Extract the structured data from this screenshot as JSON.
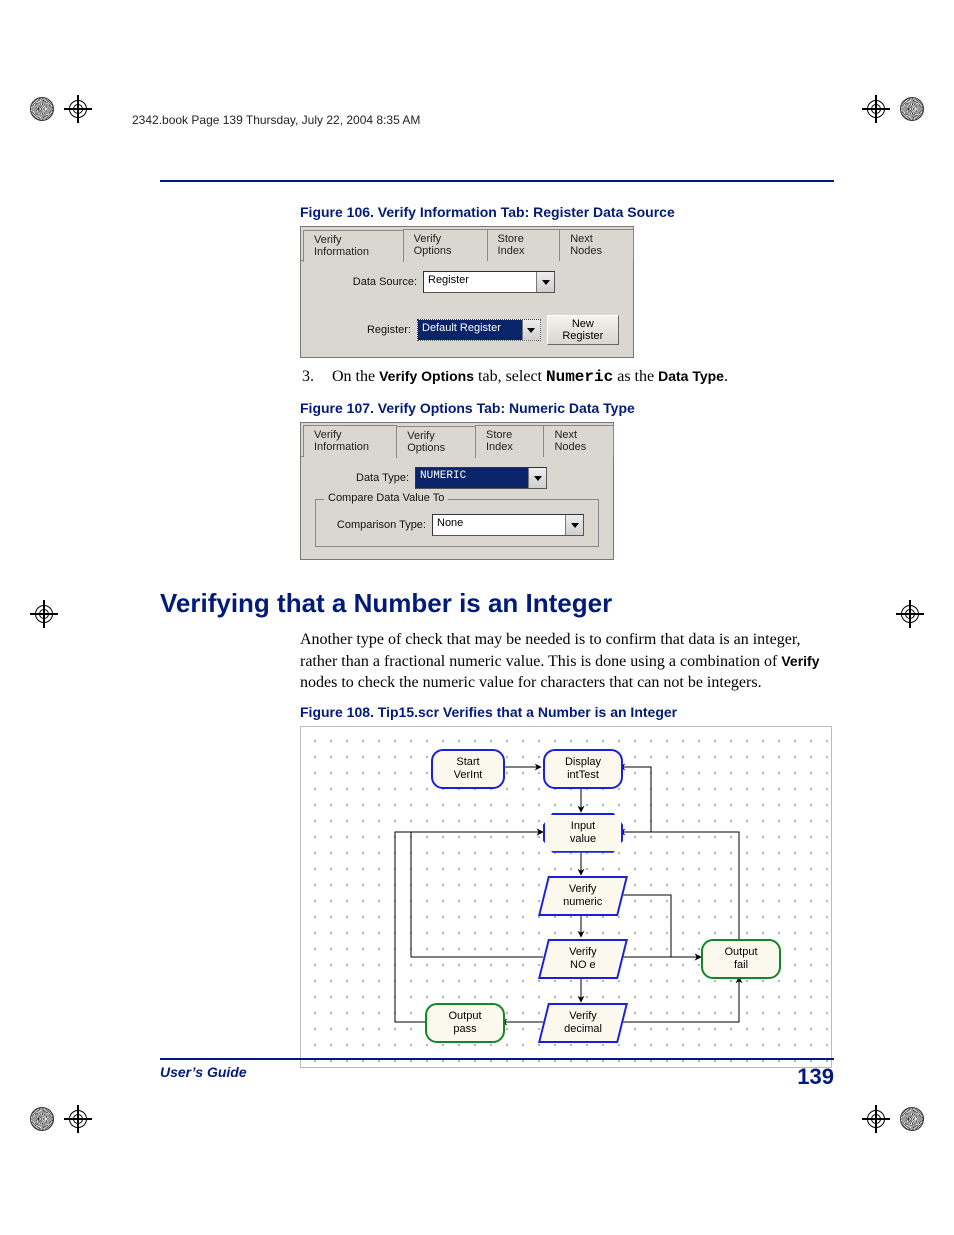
{
  "tagline": "2342.book  Page 139  Thursday, July 22, 2004  8:35 AM",
  "fig106": {
    "caption": "Figure 106. Verify Information Tab: Register Data Source",
    "tabs": [
      "Verify Information",
      "Verify Options",
      "Store Index",
      "Next Nodes"
    ],
    "active_tab": 0,
    "data_source_label": "Data Source:",
    "data_source_value": "Register",
    "register_label": "Register:",
    "register_value": "Default Register",
    "new_register_btn": "New Register"
  },
  "step3": {
    "num": "3.",
    "pre": "On the ",
    "tab_name": "Verify Options",
    "mid1": " tab, select ",
    "value": "Numeric",
    "mid2": " as the ",
    "field": "Data Type",
    "post": "."
  },
  "fig107": {
    "caption": "Figure 107. Verify Options Tab: Numeric Data Type",
    "tabs": [
      "Verify Information",
      "Verify Options",
      "Store Index",
      "Next Nodes"
    ],
    "active_tab": 1,
    "data_type_label": "Data Type:",
    "data_type_value": "NUMERIC",
    "fieldset_legend": "Compare Data Value To",
    "comparison_label": "Comparison Type:",
    "comparison_value": "None"
  },
  "heading": "Verifying that a Number is an Integer",
  "para": {
    "t1": "Another type of check that may be needed is to confirm that data is an integer, rather than a fractional numeric value. This is done using a combination of ",
    "bold": "Verify",
    "t2": " nodes to check the numeric value for characters that can not be integers."
  },
  "fig108": {
    "caption": "Figure 108. Tip15.scr Verifies that a Number is an Integer",
    "nodes": {
      "start": {
        "l1": "Start",
        "l2": "VerInt"
      },
      "display": {
        "l1": "Display",
        "l2": "intTest"
      },
      "input": {
        "l1": "Input",
        "l2": "value"
      },
      "vnum": {
        "l1": "Verify",
        "l2": "numeric"
      },
      "vnoe": {
        "l1": "Verify",
        "l2": "NO e"
      },
      "vdec": {
        "l1": "Verify",
        "l2": "decimal"
      },
      "outfail": {
        "l1": "Output",
        "l2": "fail"
      },
      "outpass": {
        "l1": "Output",
        "l2": "pass"
      }
    }
  },
  "footer": {
    "title": "User’s Guide",
    "page": "139"
  }
}
